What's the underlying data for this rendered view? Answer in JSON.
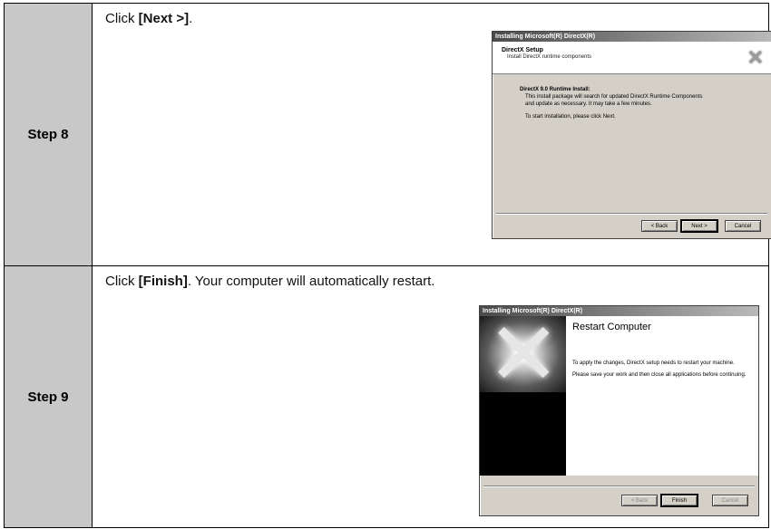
{
  "steps": [
    {
      "label": "Step 8",
      "instruction": {
        "pre": "Click ",
        "bold": "[Next >]",
        "post": "."
      },
      "dialog": {
        "title": "Installing Microsoft(R) DirectX(R)",
        "header_title": "DirectX Setup",
        "header_subtitle": "Install DirectX runtime components",
        "body_heading": "DirectX 9.0 Runtime Install:",
        "body_line1": "This install package will search for updated DirectX Runtime Components",
        "body_line2": "and update as necessary. It may take a few minutes.",
        "body_line3": "To start installation, please click Next.",
        "buttons": {
          "back": "< Back",
          "next": "Next >",
          "cancel": "Cancel"
        }
      }
    },
    {
      "label": "Step 9",
      "instruction": {
        "pre": "Click ",
        "bold": "[Finish]",
        "post": ". Your computer will automatically restart."
      },
      "dialog": {
        "title": "Installing Microsoft(R) DirectX(R)",
        "heading": "Restart Computer",
        "para1": "To apply the changes, DirectX setup needs to restart your machine.",
        "para2": "Please save your work and then close all applications before continuing.",
        "buttons": {
          "back": "< Back",
          "finish": "Finish",
          "cancel": "Cancel"
        }
      }
    }
  ]
}
